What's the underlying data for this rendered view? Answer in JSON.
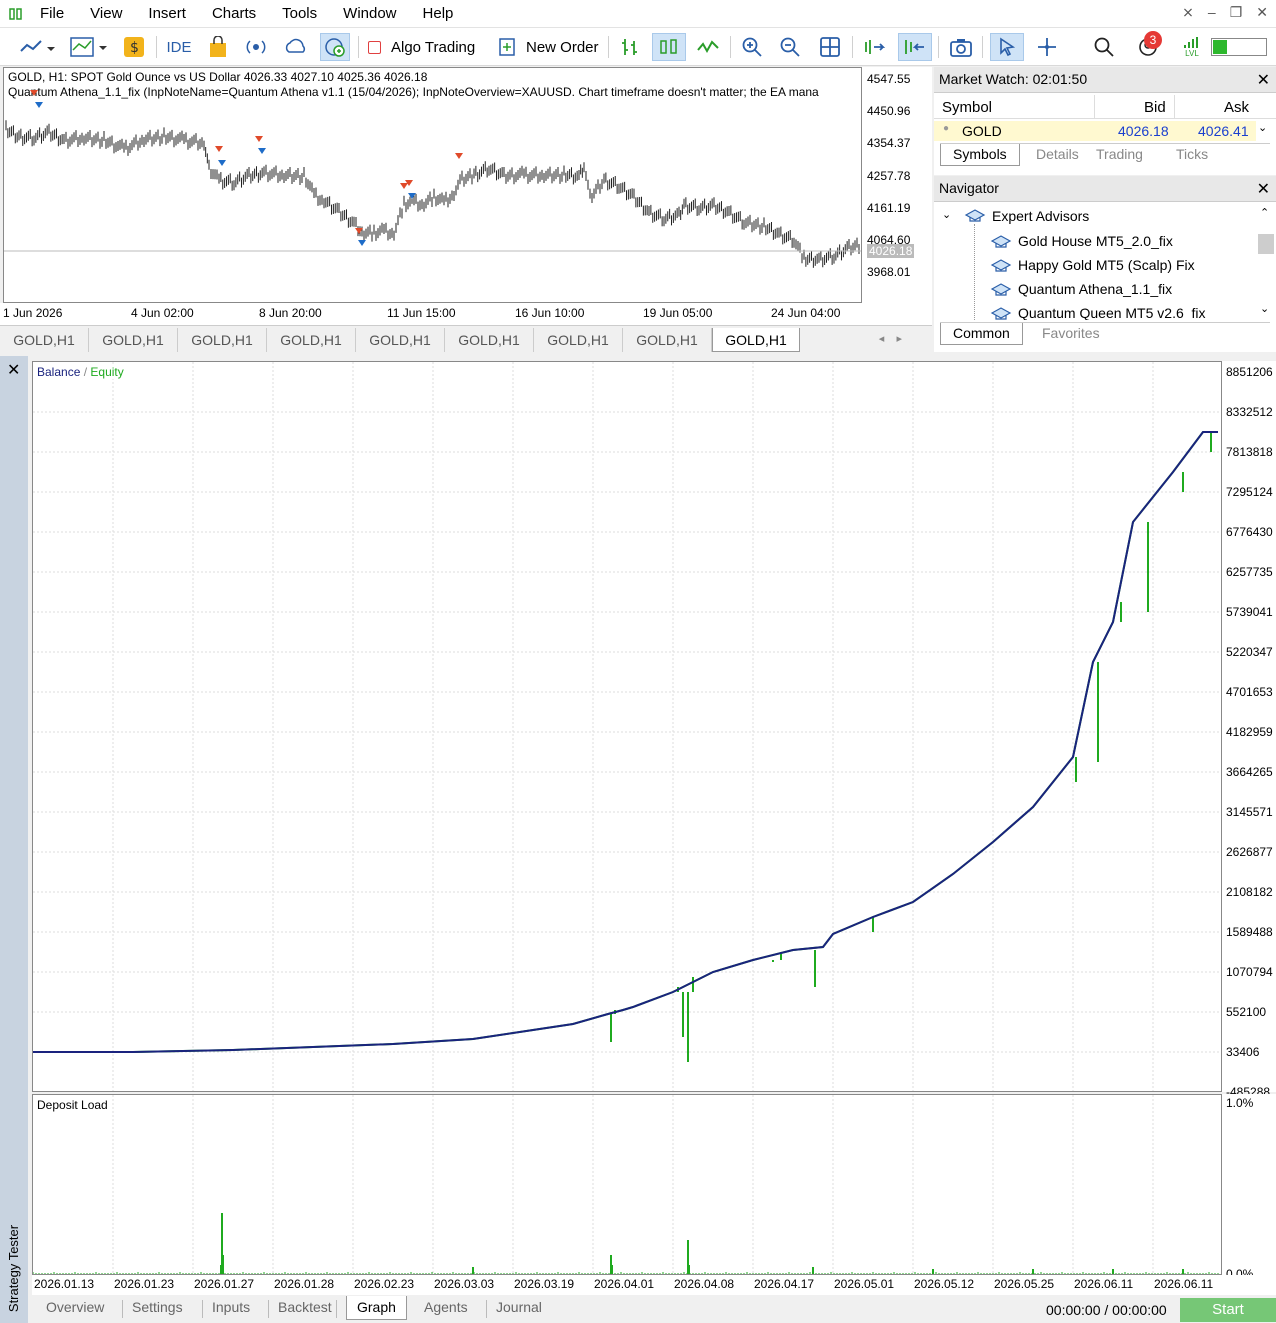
{
  "menu": {
    "items": [
      "File",
      "View",
      "Insert",
      "Charts",
      "Tools",
      "Window",
      "Help"
    ]
  },
  "toolbar": {
    "ide": "IDE",
    "algo_trading": "Algo Trading",
    "new_order": "New Order",
    "notifications_badge": "3",
    "lvl_label": "LVL"
  },
  "chart": {
    "header_line1": "GOLD, H1:  SPOT Gold Ounce vs US Dollar  4026.33 4027.10 4025.36 4026.18",
    "header_line2": "Quantum Athena_1.1_fix (InpNoteName=Quantum Athena v1.1 (15/04/2026); InpNoteOverview=XAUUSD. Chart timeframe doesn't matter; the EA mana",
    "price_labels": [
      "4547.55",
      "4450.96",
      "4354.37",
      "4257.78",
      "4161.19",
      "4064.60",
      "3968.01"
    ],
    "current_price": "4026.18",
    "time_labels": [
      "1 Jun 2026",
      "4 Jun 02:00",
      "8 Jun 20:00",
      "11 Jun 15:00",
      "16 Jun 10:00",
      "19 Jun 05:00",
      "24 Jun 04:00"
    ],
    "tabs": [
      "GOLD,H1",
      "GOLD,H1",
      "GOLD,H1",
      "GOLD,H1",
      "GOLD,H1",
      "GOLD,H1",
      "GOLD,H1",
      "GOLD,H1",
      "GOLD,H1"
    ]
  },
  "market_watch": {
    "title": "Market Watch: 02:01:50",
    "col_symbol": "Symbol",
    "col_bid": "Bid",
    "col_ask": "Ask",
    "row": {
      "symbol": "GOLD",
      "bid": "4026.18",
      "ask": "4026.41"
    },
    "tabs": [
      "Symbols",
      "Details",
      "Trading",
      "Ticks"
    ]
  },
  "navigator": {
    "title": "Navigator",
    "root": "Expert Advisors",
    "items": [
      "Gold House MT5_2.0_fix",
      "Happy Gold MT5 (Scalp) Fix",
      "Quantum Athena_1.1_fix",
      "Quantum Queen MT5 v2.6_fix"
    ],
    "tabs": [
      "Common",
      "Favorites"
    ]
  },
  "tester": {
    "side_label": "Strategy Tester",
    "balance_label": "Balance",
    "equity_label": "Equity",
    "deposit_label": "Deposit Load",
    "balance_axis": [
      "8851206",
      "8332512",
      "7813818",
      "7295124",
      "6776430",
      "6257735",
      "5739041",
      "5220347",
      "4701653",
      "4182959",
      "3664265",
      "3145571",
      "2626877",
      "2108182",
      "1589488",
      "1070794",
      "552100",
      "33406",
      "-485288"
    ],
    "deposit_axis": [
      "1.0%",
      "0.0%"
    ],
    "time_labels": [
      "2026.01.13",
      "2026.01.23",
      "2026.01.27",
      "2026.01.28",
      "2026.02.23",
      "2026.03.03",
      "2026.03.19",
      "2026.04.01",
      "2026.04.08",
      "2026.04.17",
      "2026.05.01",
      "2026.05.12",
      "2026.05.25",
      "2026.06.11",
      "2026.06.11"
    ],
    "tabs": [
      "Overview",
      "Settings",
      "Inputs",
      "Backtest",
      "Graph",
      "Agents",
      "Journal"
    ],
    "time": "00:00:00 / 00:00:00",
    "start": "Start"
  },
  "colors": {
    "balance": "#1a237e",
    "equity": "#1faa1f",
    "accent": "#76c776"
  }
}
